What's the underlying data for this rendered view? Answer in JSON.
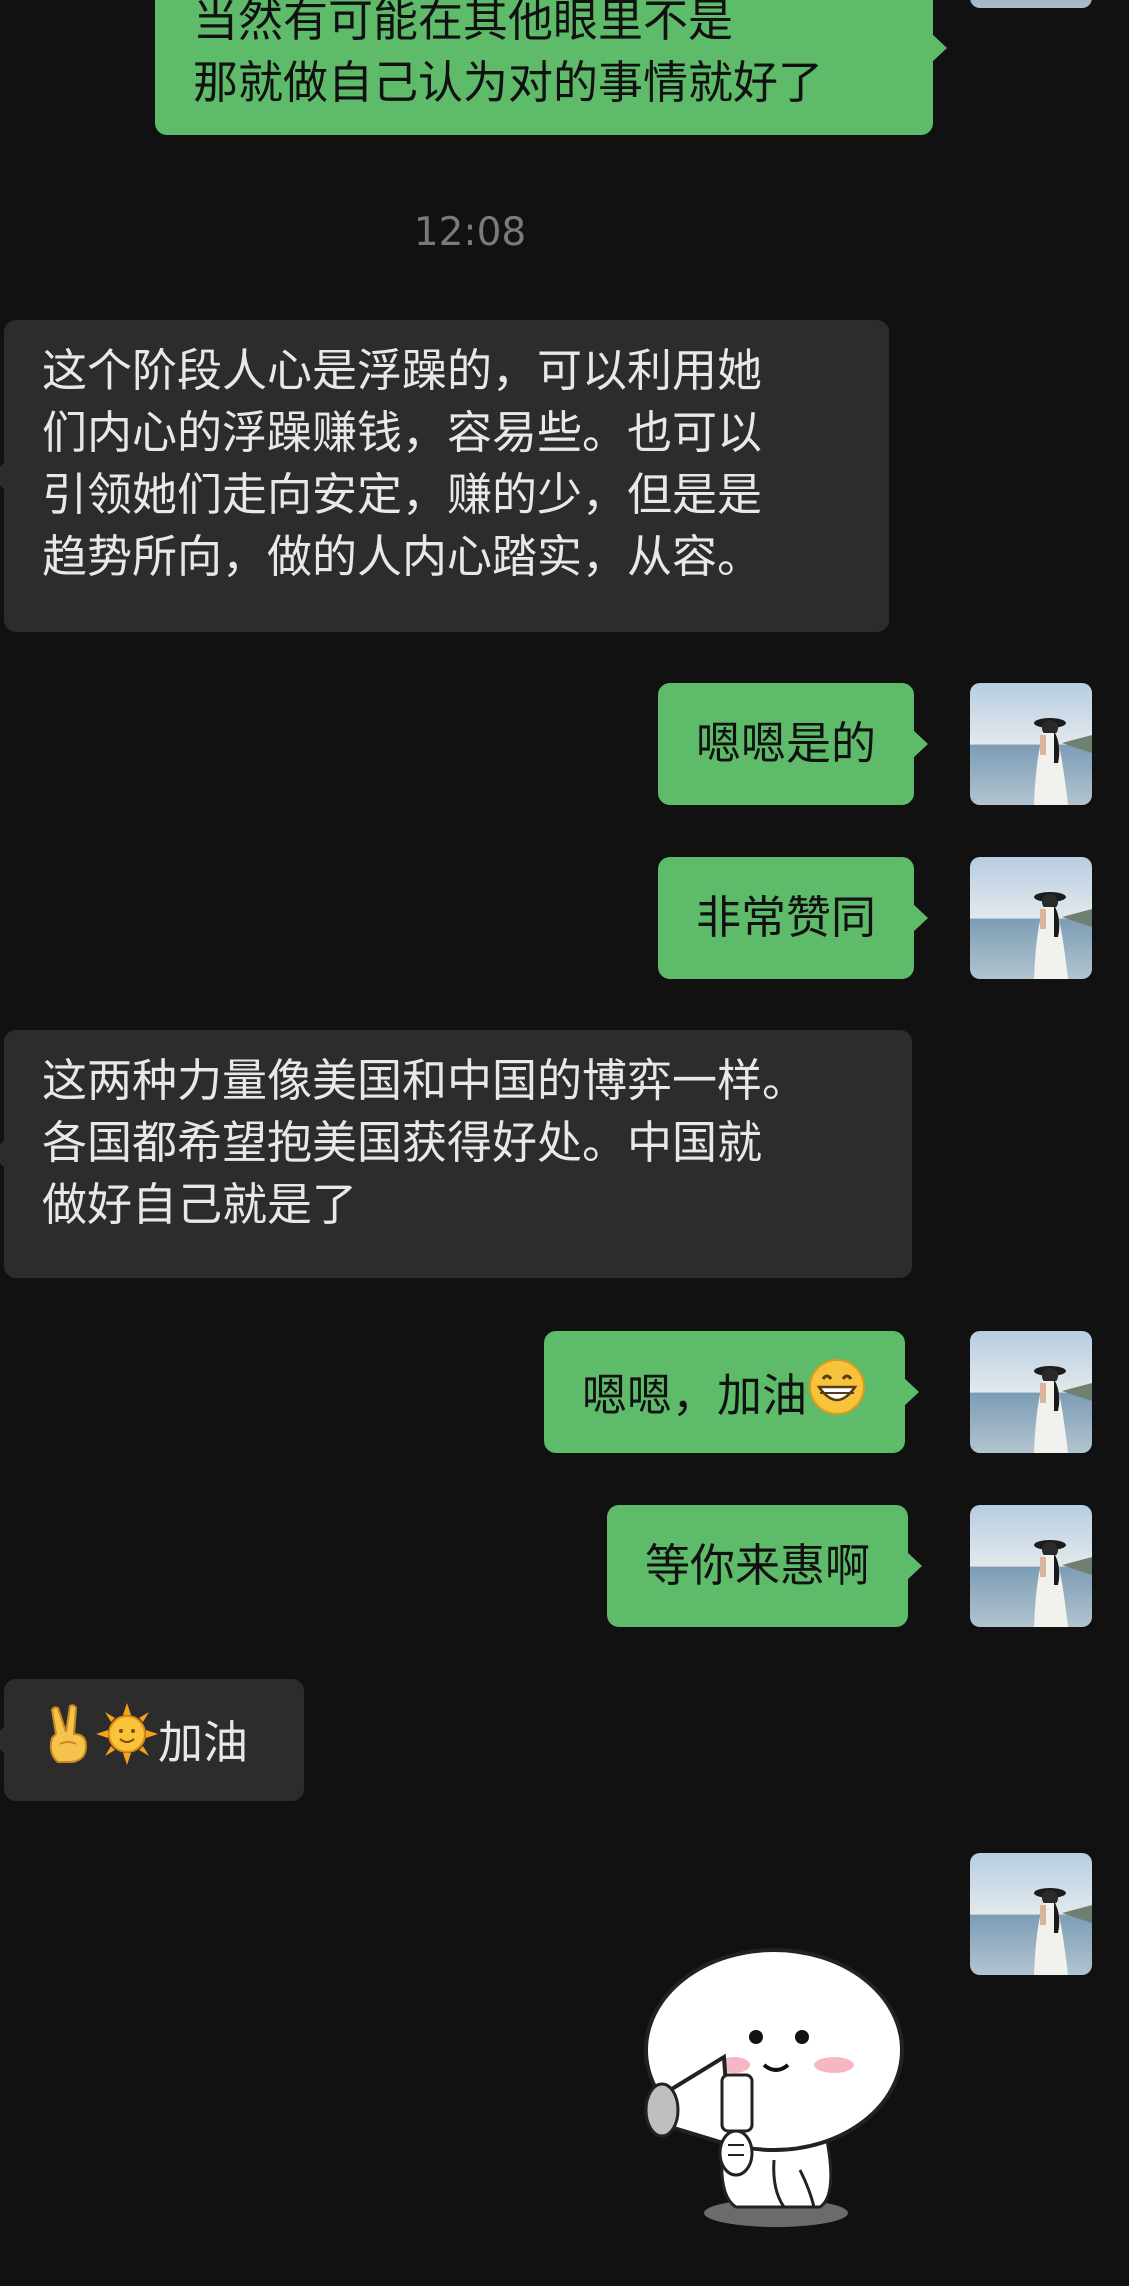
{
  "chat": {
    "timestamp": "12:08",
    "messages": [
      {
        "side": "out",
        "lines": [
          "当然有可能在其他眼里不是",
          "那就做自己认为对的事情就好了"
        ]
      },
      {
        "side": "in",
        "lines": [
          "这个阶段人心是浮躁的，可以利用她",
          "们内心的浮躁赚钱，容易些。也可以",
          "引领她们走向安定，赚的少，但是是",
          "趋势所向，做的人内心踏实，从容。"
        ]
      },
      {
        "side": "out",
        "text": "嗯嗯是的"
      },
      {
        "side": "out",
        "text": "非常赞同"
      },
      {
        "side": "in",
        "lines": [
          "这两种力量像美国和中国的博弈一样。",
          "各国都希望抱美国获得好处。中国就",
          "做好自己就是了"
        ]
      },
      {
        "side": "out",
        "text": "嗯嗯，加油",
        "trailing_icon": "grinning-face-icon"
      },
      {
        "side": "out",
        "text": "等你来惠啊"
      },
      {
        "side": "in",
        "text": "加油",
        "leading_icons": [
          "victory-hand-icon",
          "sun-face-icon"
        ]
      },
      {
        "side": "out",
        "sticker": "megaphone-sticker"
      }
    ]
  },
  "colors": {
    "background": "#111111",
    "outgoing_bubble": "#5ebb6a",
    "incoming_bubble": "#2c2c2c",
    "timestamp": "#7a7a7a"
  }
}
